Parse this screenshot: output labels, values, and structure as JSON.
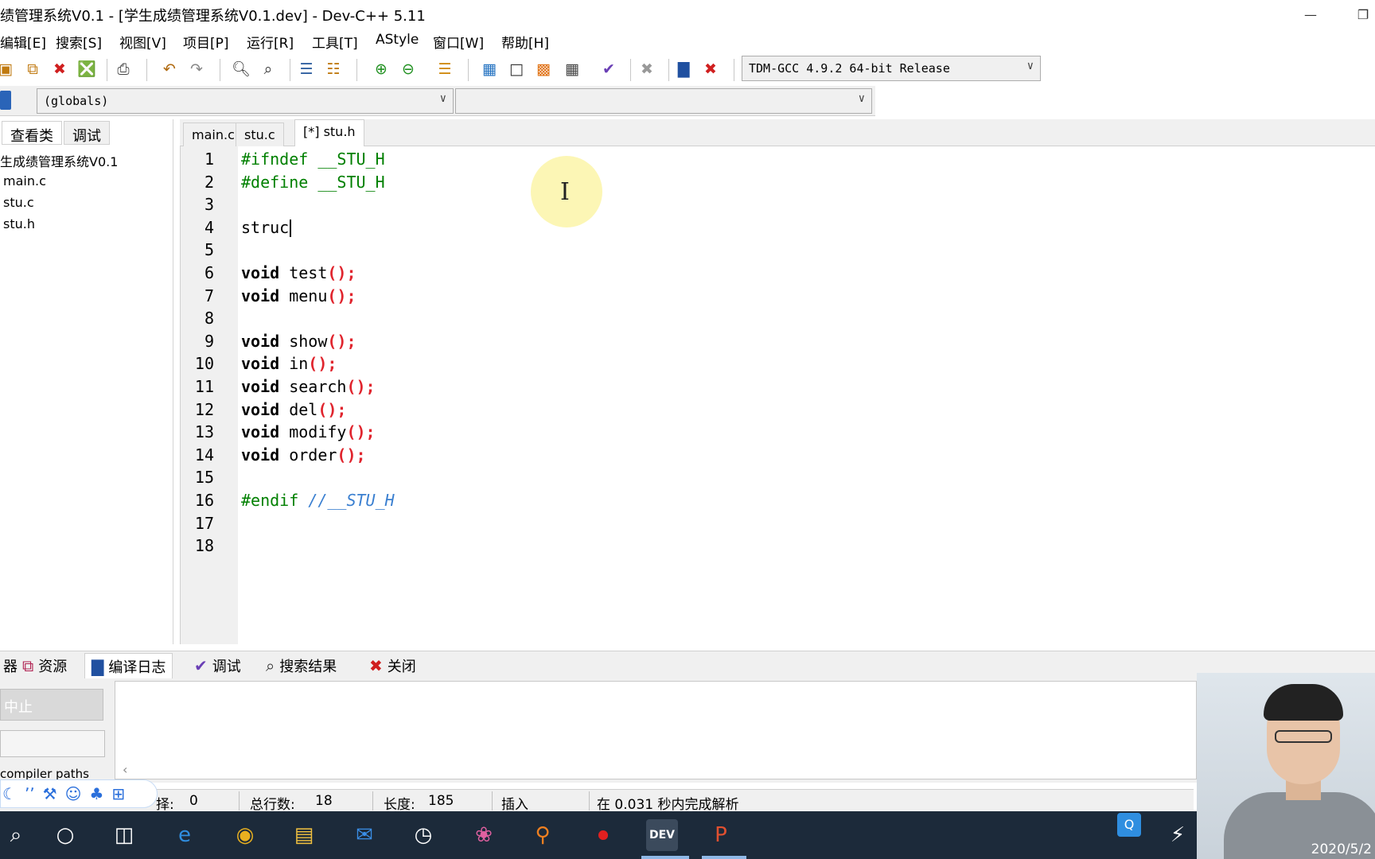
{
  "window": {
    "title": "绩管理系统V0.1 - [学生成绩管理系统V0.1.dev] - Dev-C++ 5.11",
    "minimize_icon": "minimize-icon",
    "restore_icon": "restore-icon"
  },
  "menu": {
    "items": [
      "编辑[E]",
      "搜索[S]",
      "视图[V]",
      "项目[P]",
      "运行[R]",
      "工具[T]",
      "AStyle",
      "窗口[W]",
      "帮助[H]"
    ]
  },
  "toolbar": {
    "compiler": "TDM-GCC 4.9.2 64-bit Release"
  },
  "toolbar2": {
    "scope": "(globals)",
    "function": ""
  },
  "left_panel": {
    "tabs": [
      "查看类",
      "调试"
    ],
    "project": "生成绩管理系统V0.1",
    "files": [
      "main.c",
      "stu.c",
      "stu.h"
    ]
  },
  "editor": {
    "tabs": [
      "main.c",
      "stu.c",
      "[*] stu.h"
    ],
    "active_tab": "[*] stu.h",
    "line_numbers": [
      "1",
      "2",
      "3",
      "4",
      "5",
      "6",
      "7",
      "8",
      "9",
      "10",
      "11",
      "12",
      "13",
      "14",
      "15",
      "16",
      "17",
      "18"
    ],
    "lines": {
      "l1": "#ifndef __STU_H",
      "l2": "#define __STU_H",
      "l4": "struc",
      "l6_kw": "void",
      "l6_name": " test",
      "l6_p": "();",
      "l7_kw": "void",
      "l7_name": " menu",
      "l7_p": "();",
      "l9_kw": "void",
      "l9_name": " show",
      "l9_p": "();",
      "l10_kw": "void",
      "l10_name": " in",
      "l10_p": "();",
      "l11_kw": "void",
      "l11_name": " search",
      "l11_p": "();",
      "l12_kw": "void",
      "l12_name": " del",
      "l12_p": "();",
      "l13_kw": "void",
      "l13_name": " modify",
      "l13_p": "();",
      "l14_kw": "void",
      "l14_name": " order",
      "l14_p": "();",
      "l16_pp": "#endif",
      "l16_cmt": " //__STU_H"
    }
  },
  "bottom_tabs": {
    "t0": "器",
    "t1": "资源",
    "t2": "编译日志",
    "t3": "调试",
    "t4": "搜索结果",
    "t5": "关闭"
  },
  "bottom_panel": {
    "stop": "中止",
    "compiler_paths": "compiler paths"
  },
  "status": {
    "sel_label": "择:",
    "sel_value": "0",
    "lines_label": "总行数:",
    "lines_value": "18",
    "length_label": "长度:",
    "length_value": "185",
    "mode": "插入",
    "parse": "在 0.031 秒内完成解析"
  },
  "taskbar": {
    "clock": "2020/5/2"
  }
}
